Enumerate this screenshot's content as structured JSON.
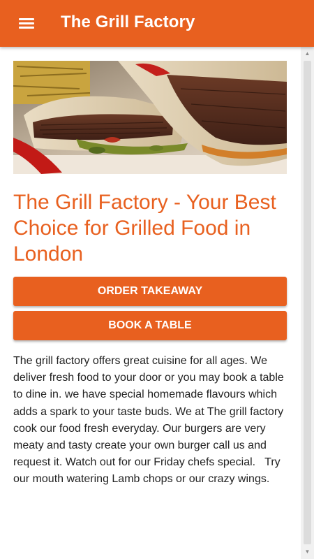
{
  "app_bar": {
    "title": "The Grill Factory",
    "menu_icon": "hamburger-menu-icon",
    "background_color": "#E8601F"
  },
  "main": {
    "hero_image_description": "grilled-wrap-photo",
    "headline": "The Grill Factory - Your Best Choice for Grilled Food in London",
    "buttons": {
      "order_takeaway": "ORDER TAKEAWAY",
      "book_table": "BOOK A TABLE"
    },
    "description": "The grill factory offers great cuisine for all ages. We deliver fresh food to your door or you may book a table to dine in. we have special homemade flavours which adds a spark to your taste buds. We at The grill factory cook our food fresh everyday. Our burgers are very meaty and tasty create your own burger call us and request it. Watch out for our Friday chefs special.   Try our mouth watering Lamb chops or our crazy wings."
  },
  "colors": {
    "accent": "#E8601F",
    "text": "#222222"
  }
}
